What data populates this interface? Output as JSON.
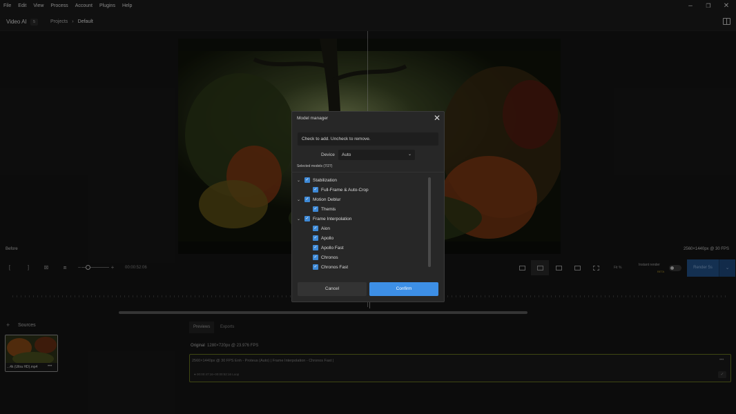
{
  "menu": [
    "File",
    "Edit",
    "View",
    "Process",
    "Account",
    "Plugins",
    "Help"
  ],
  "header": {
    "app_title": "Video AI",
    "badge": "5",
    "crumb_projects": "Projects",
    "crumb_current": "Default"
  },
  "viewer": {
    "before_label": "Before",
    "output_resolution": "2560×1440px @ 30 FPS"
  },
  "toolbar": {
    "timecode": "00:00:52:06",
    "fit_label": "Fit %",
    "instant_render": "Instant render",
    "beta": "BETA",
    "render_label": "Render 5s"
  },
  "sources": {
    "label": "Sources",
    "file_name": "...4k (Ultra HD).mp4",
    "more": "•••"
  },
  "panel": {
    "tabs": [
      "Previews",
      "Exports"
    ],
    "original_label": "Original",
    "original_info": "1280×720px @ 23.976 FPS",
    "export_line": "2560×1440px @ 30 FPS   Enh - Proteus (Auto)   |   Frame Interpolation - Chronos Fast   |",
    "export_time": "● 00:00:47:16–00:00:52:16     Loop"
  },
  "dialog": {
    "title": "Model manager",
    "hint": "Check to add. Uncheck to remove.",
    "device_label": "Device",
    "device_value": "Auto",
    "selected_count": "Selected models (7/27)",
    "groups": [
      {
        "name": "Stabilization",
        "models": [
          "Full-Frame & Auto-Crop"
        ]
      },
      {
        "name": "Motion Deblur",
        "models": [
          "Themis"
        ]
      },
      {
        "name": "Frame Interpolation",
        "models": [
          "Aion",
          "Apollo",
          "Apollo Fast",
          "Chronos",
          "Chronos Fast"
        ]
      }
    ],
    "cancel_label": "Cancel",
    "confirm_label": "Confirm"
  },
  "colors": {
    "accent": "#3d8fe6",
    "checkbox": "#3e89d6",
    "render_button": "#24538c",
    "export_border": "#6d7a22"
  }
}
